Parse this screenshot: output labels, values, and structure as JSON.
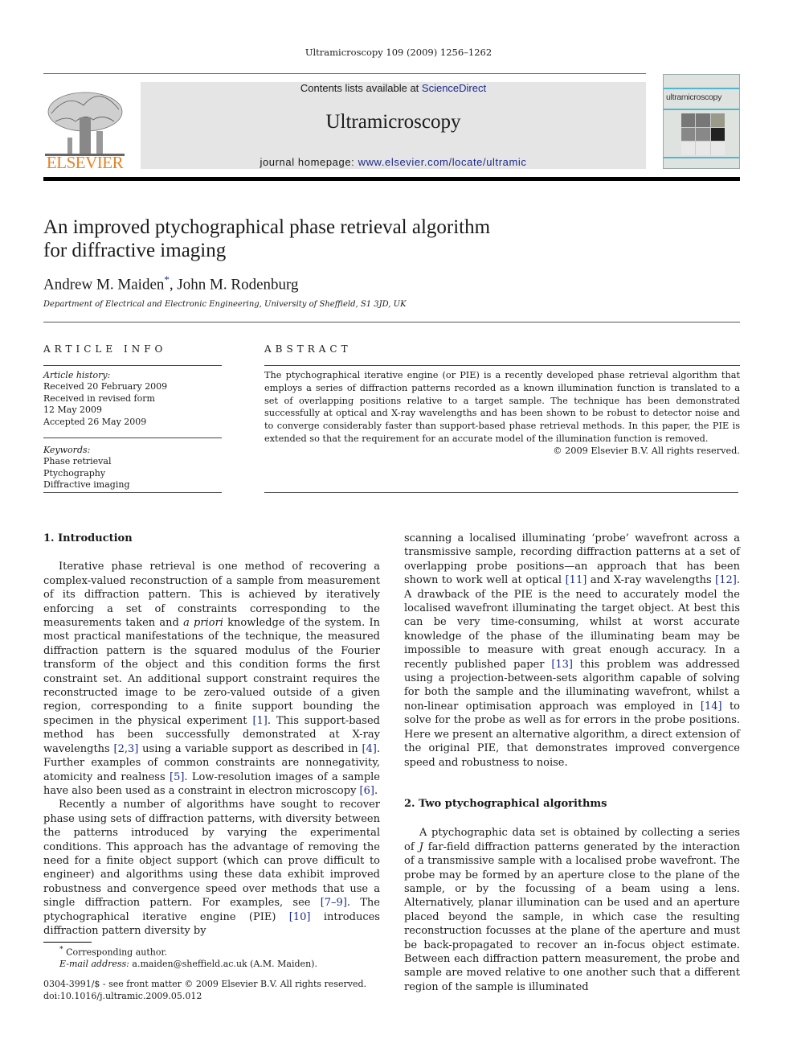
{
  "running_head": "Ultramicroscopy 109 (2009) 1256–1262",
  "masthead": {
    "publisher_logo": "ELSEVIER",
    "contents_prefix": "Contents lists available at ",
    "contents_link": "ScienceDirect",
    "journal_title": "Ultramicroscopy",
    "homepage_prefix": "journal homepage: ",
    "homepage_link": "www.elsevier.com/locate/ultramic",
    "cover_title": "ultramicroscopy",
    "colors": {
      "publisher_orange": "#e8811f",
      "link_blue": "#1a2a8a",
      "masthead_gray": "#e5e5e5",
      "cover_teal": "#4fb7cf"
    }
  },
  "article": {
    "title_line1": "An improved ptychographical phase retrieval algorithm",
    "title_line2": "for diffractive imaging",
    "author1": "Andrew M. Maiden",
    "author1_mark": "*",
    "author_sep": ", ",
    "author2": "John M. Rodenburg",
    "affiliation": "Department of Electrical and Electronic Engineering, University of Sheffield, S1 3JD, UK"
  },
  "article_info": {
    "heading": "ARTICLE INFO",
    "history_label": "Article history:",
    "history": [
      "Received 20 February 2009",
      "Received in revised form",
      "12 May 2009",
      "Accepted 26 May 2009"
    ],
    "keywords_label": "Keywords:",
    "keywords": [
      "Phase retrieval",
      "Ptychography",
      "Diffractive imaging"
    ]
  },
  "abstract": {
    "heading": "ABSTRACT",
    "text": "The ptychographical iterative engine (or PIE) is a recently developed phase retrieval algorithm that employs a series of diffraction patterns recorded as a known illumination function is translated to a set of overlapping positions relative to a target sample. The technique has been demonstrated successfully at optical and X-ray wavelengths and has been shown to be robust to detector noise and to converge considerably faster than support-based phase retrieval methods. In this paper, the PIE is extended so that the requirement for an accurate model of the illumination function is removed.",
    "copyright": "© 2009 Elsevier B.V. All rights reserved."
  },
  "body": {
    "sec1_heading": "1.  Introduction",
    "p1": [
      "Iterative phase retrieval is one method of recovering a complex-valued reconstruction of a sample from measurement of its diffraction pattern. This is achieved by iteratively enforcing a set of constraints corresponding to the measurements taken and ",
      "a priori",
      " knowledge of the system. In most practical manifestations of the technique, the measured diffraction pattern is the squared modulus of the Fourier transform of the object and this condition forms the first constraint set. An additional support constraint requires the reconstructed image to be zero-valued outside of a given region, corresponding to a finite support bounding the specimen in the physical experiment ",
      "[1]",
      ". This support-based method has been successfully demonstrated at X-ray wavelengths ",
      "[2,3]",
      " using a variable support as described in ",
      "[4]",
      ". Further examples of common constraints are nonnegativity, atomicity and realness ",
      "[5]",
      ". Low-resolution images of a sample have also been used as a constraint in electron microscopy ",
      "[6]",
      "."
    ],
    "p2": [
      "Recently a number of algorithms have sought to recover phase using sets of diffraction patterns, with diversity between the patterns introduced by varying the experimental conditions. This approach has the advantage of removing the need for a finite object support (which can prove difficult to engineer) and algorithms using these data exhibit improved robustness and convergence speed over methods that use a single diffraction pattern. For examples, see ",
      "[7–9]",
      ". The ptychographical iterative engine (PIE) ",
      "[10]",
      " introduces diffraction pattern diversity by"
    ],
    "p3": [
      "scanning a localised illuminating ‘probe’ wavefront across a transmissive sample, recording diffraction patterns at a set of overlapping probe positions—an approach that has been shown to work well at optical ",
      "[11]",
      " and X-ray wavelengths ",
      "[12]",
      ". A drawback of the PIE is the need to accurately model the localised wavefront illuminating the target object. At best this can be very time-consuming, whilst at worst accurate knowledge of the phase of the illuminating beam may be impossible to measure with great enough accuracy. In a recently published paper ",
      "[13]",
      " this problem was addressed using a projection-between-sets algorithm capable of solving for both the sample and the illuminating wavefront, whilst a non-linear optimisation approach was employed in ",
      "[14]",
      " to solve for the probe as well as for errors in the probe positions. Here we present an alternative algorithm, a direct extension of the original PIE, that demonstrates improved convergence speed and robustness to noise."
    ],
    "sec2_heading": "2.  Two ptychographical algorithms",
    "p4": [
      "A ptychographic data set is obtained by collecting a series of ",
      "J",
      " far-field diffraction patterns generated by the interaction of a transmissive sample with a localised probe wavefront. The probe may be formed by an aperture close to the plane of the sample, or by the focussing of a beam using a lens. Alternatively, planar illumination can be used and an aperture placed beyond the sample, in which case the resulting reconstruction focusses at the plane of the aperture and must be back-propagated to recover an in-focus object estimate. Between each diffraction pattern measurement, the probe and sample are moved relative to one another such that a different region of the sample is illuminated"
    ]
  },
  "footnotes": {
    "mark": "*",
    "corresponding": " Corresponding author.",
    "email_label": "E-mail address:",
    "email": " a.maiden@sheffield.ac.uk (A.M. Maiden).",
    "issn_line": "0304-3991/$ - see front matter © 2009 Elsevier B.V. All rights reserved.",
    "doi_line": "doi:10.1016/j.ultramic.2009.05.012"
  }
}
